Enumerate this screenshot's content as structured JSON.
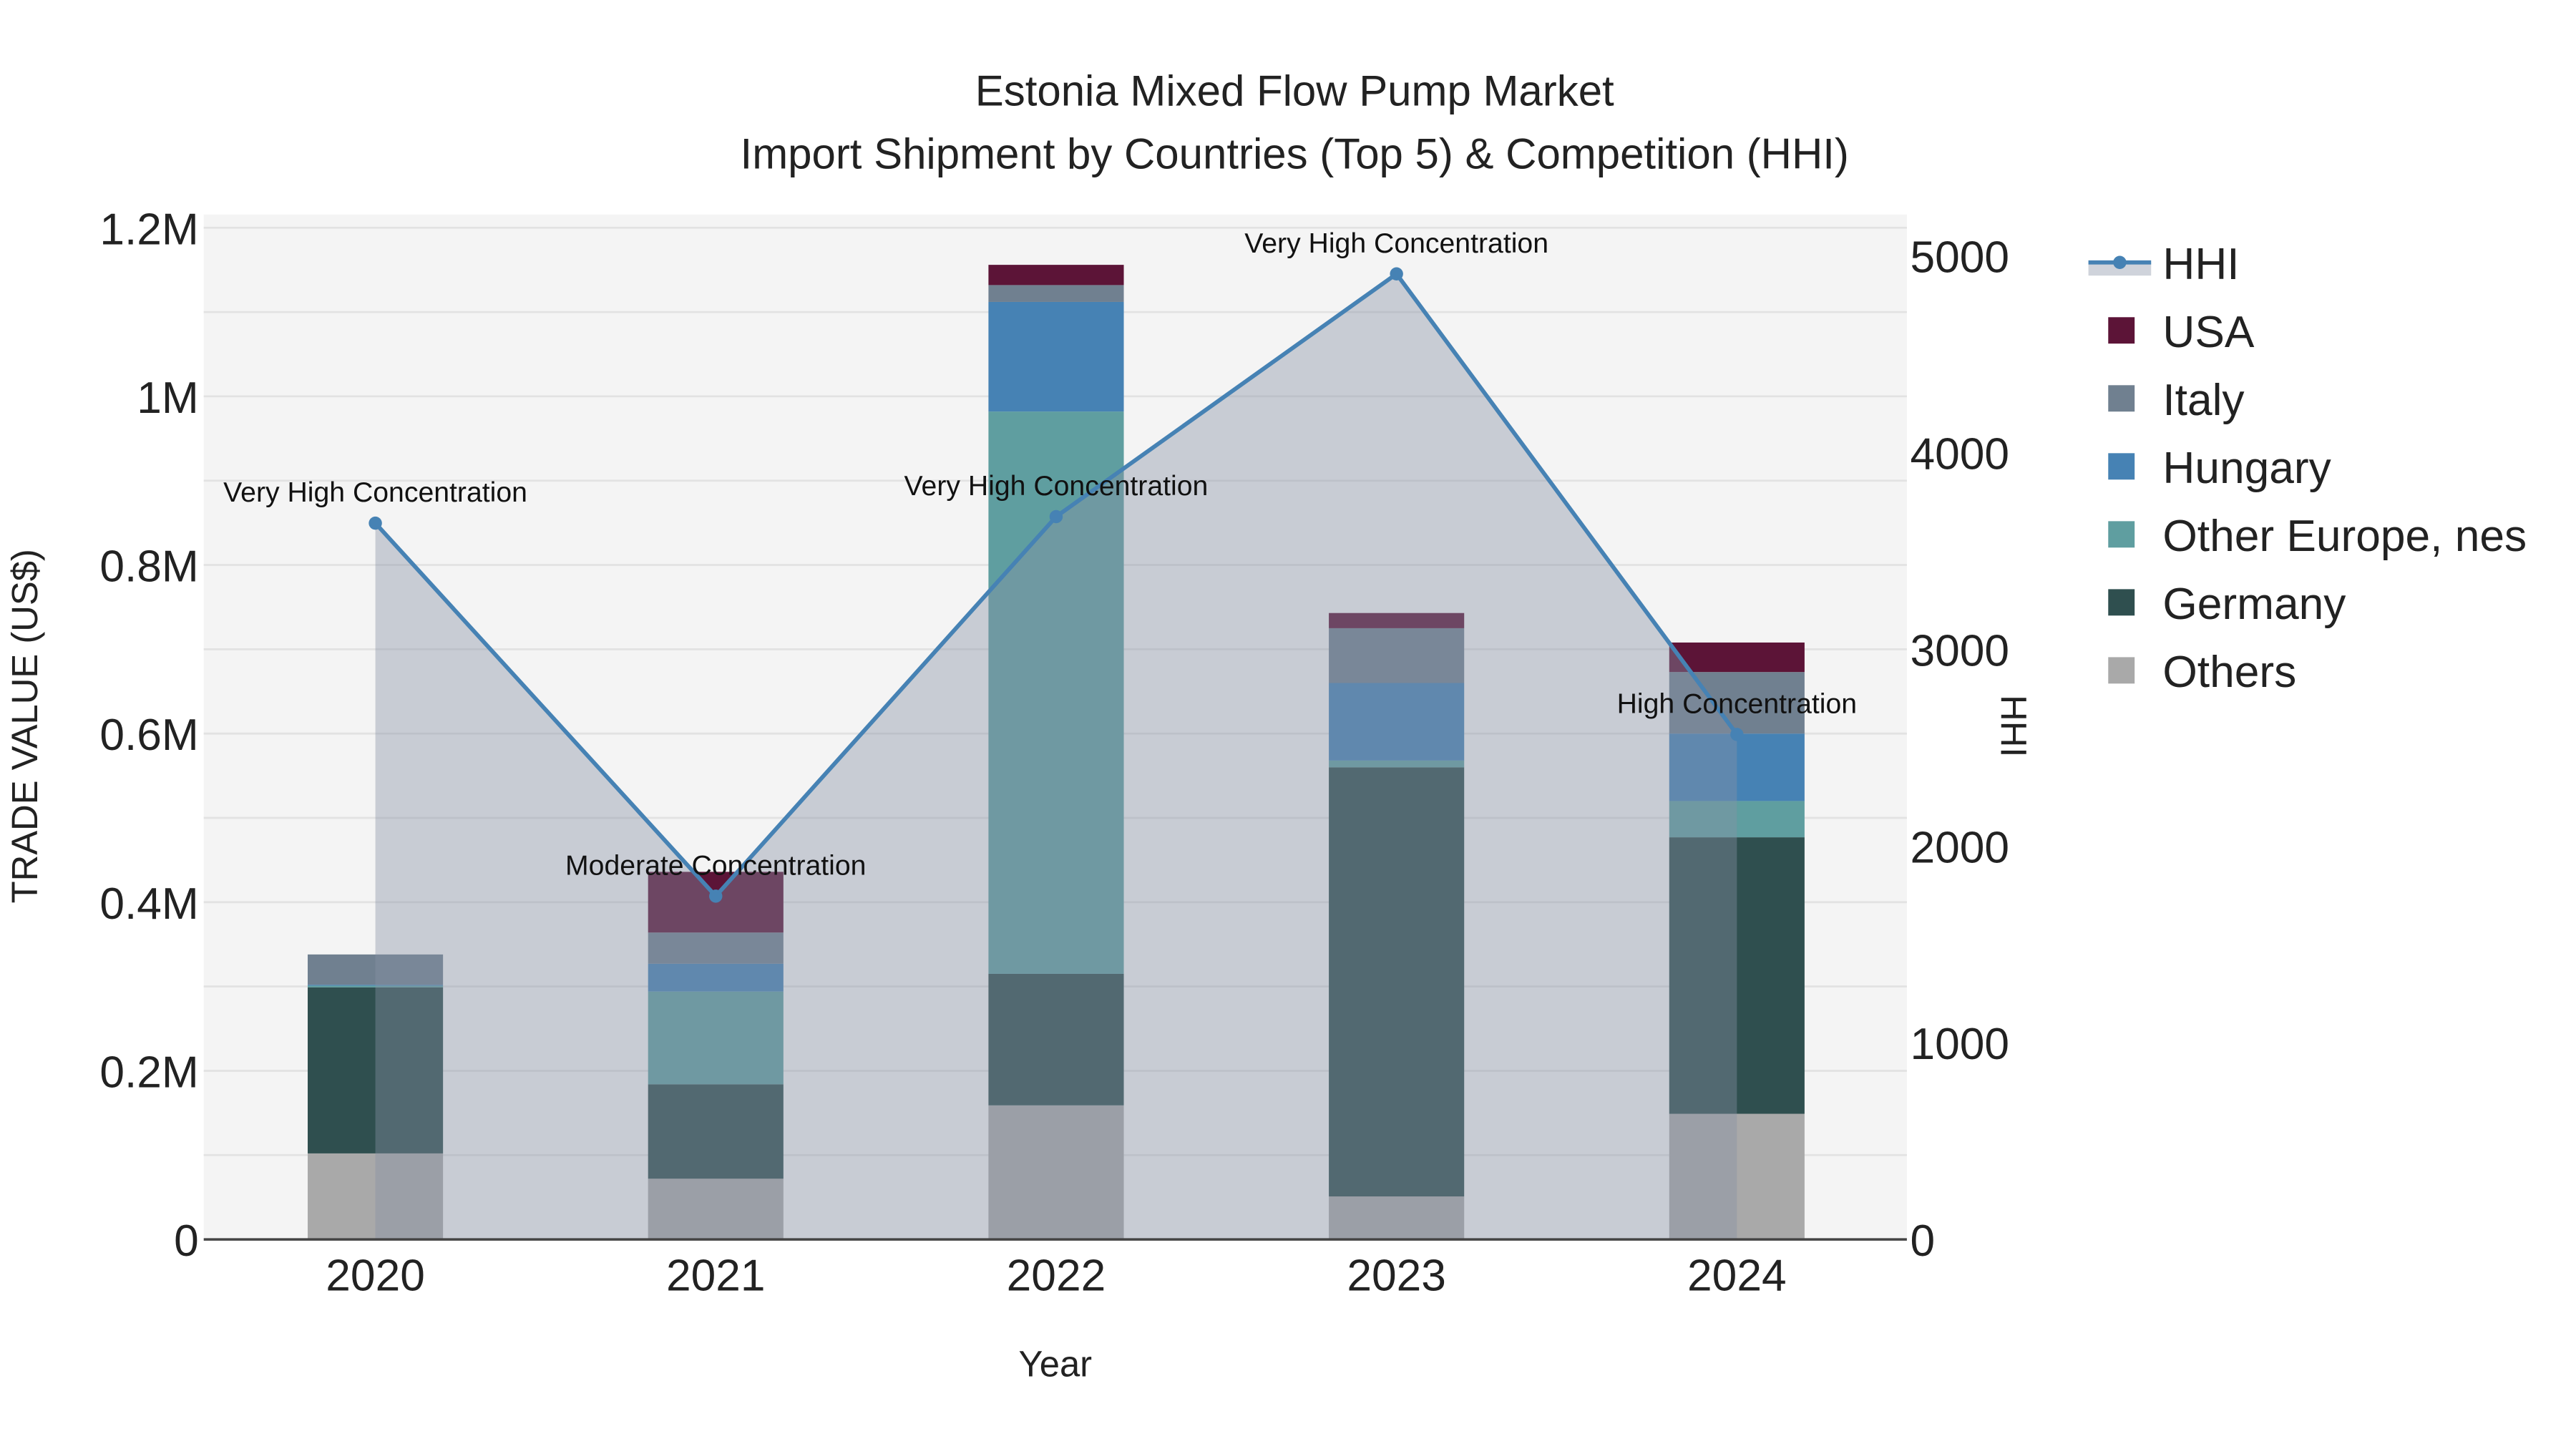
{
  "chart_data": {
    "type": "bar",
    "title": "Estonia Mixed Flow Pump Market",
    "subtitle": "Import Shipment by Countries (Top 5) & Competition (HHI)",
    "xlabel": "Year",
    "ylabel": "TRADE VALUE (US$)",
    "y2label": "HHI",
    "categories": [
      "2020",
      "2021",
      "2022",
      "2023",
      "2024"
    ],
    "ylim": [
      0,
      1220000
    ],
    "y2lim": [
      0,
      5200
    ],
    "yticks": [
      {
        "v": 0,
        "label": "0"
      },
      {
        "v": 200000,
        "label": "0.2M"
      },
      {
        "v": 400000,
        "label": "0.4M"
      },
      {
        "v": 600000,
        "label": "0.6M"
      },
      {
        "v": 800000,
        "label": "0.8M"
      },
      {
        "v": 1000000,
        "label": "1M"
      },
      {
        "v": 1200000,
        "label": "1.2M"
      }
    ],
    "y2ticks": [
      {
        "v": 0,
        "label": "0"
      },
      {
        "v": 1000,
        "label": "1000"
      },
      {
        "v": 2000,
        "label": "2000"
      },
      {
        "v": 3000,
        "label": "3000"
      },
      {
        "v": 4000,
        "label": "4000"
      },
      {
        "v": 5000,
        "label": "5000"
      }
    ],
    "stacked": true,
    "series": [
      {
        "name": "Others",
        "color": "#a9a9a9",
        "values": [
          102000,
          72000,
          159000,
          51000,
          149000
        ]
      },
      {
        "name": "Germany",
        "color": "#2f4f4f",
        "values": [
          197000,
          112000,
          156000,
          509000,
          328000
        ]
      },
      {
        "name": "Other Europe, nes",
        "color": "#5f9ea0",
        "values": [
          2000,
          110000,
          667000,
          8000,
          43000
        ]
      },
      {
        "name": "Hungary",
        "color": "#4682b4",
        "values": [
          1000,
          33000,
          130000,
          92000,
          80000
        ]
      },
      {
        "name": "Italy",
        "color": "#708090",
        "values": [
          36000,
          37000,
          20000,
          65000,
          73000
        ]
      },
      {
        "name": "USA",
        "color": "#5c1437",
        "values": [
          0,
          72000,
          24000,
          18000,
          35000
        ]
      }
    ],
    "line": {
      "name": "HHI",
      "color": "#4682b4",
      "values": [
        3641,
        1745,
        3674,
        4908,
        2567
      ]
    },
    "annotations": [
      "Very High Concentration",
      "Moderate Concentration",
      "Very High Concentration",
      "Very High Concentration",
      "High Concentration"
    ],
    "legend_order": [
      "HHI",
      "USA",
      "Italy",
      "Hungary",
      "Other Europe, nes",
      "Germany",
      "Others"
    ],
    "legend_position": "right",
    "grid": true
  }
}
